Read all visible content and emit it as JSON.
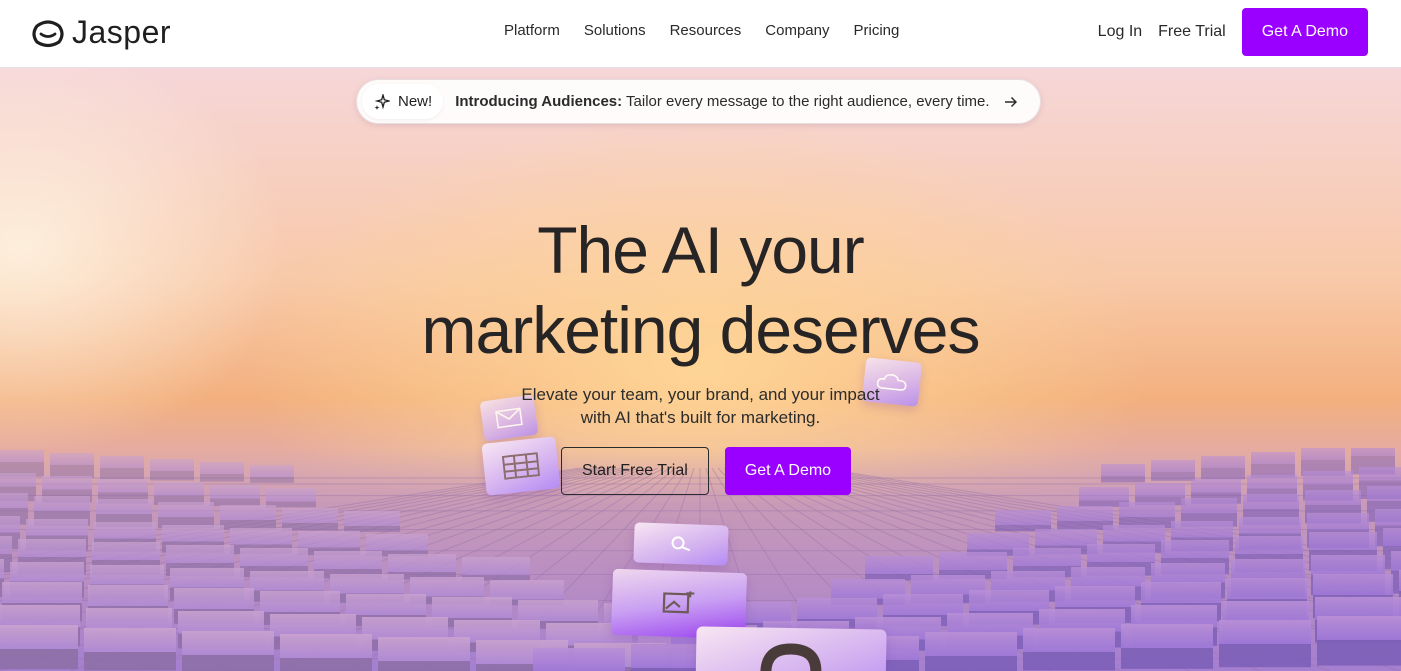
{
  "brand": {
    "name": "Jasper"
  },
  "nav": {
    "links": [
      "Platform",
      "Solutions",
      "Resources",
      "Company",
      "Pricing"
    ],
    "login": "Log In",
    "free_trial": "Free Trial",
    "demo": "Get A Demo"
  },
  "announcement": {
    "badge": "New!",
    "title": "Introducing Audiences:",
    "text": "Tailor every message to the right audience, every time."
  },
  "hero": {
    "headline_line1": "The AI your",
    "headline_line2": "marketing deserves",
    "sub_line1": "Elevate your team, your brand, and your impact",
    "sub_line2": "with AI that's built for marketing.",
    "cta_trial": "Start Free Trial",
    "cta_demo": "Get A Demo"
  },
  "colors": {
    "accent": "#9a00ff"
  }
}
